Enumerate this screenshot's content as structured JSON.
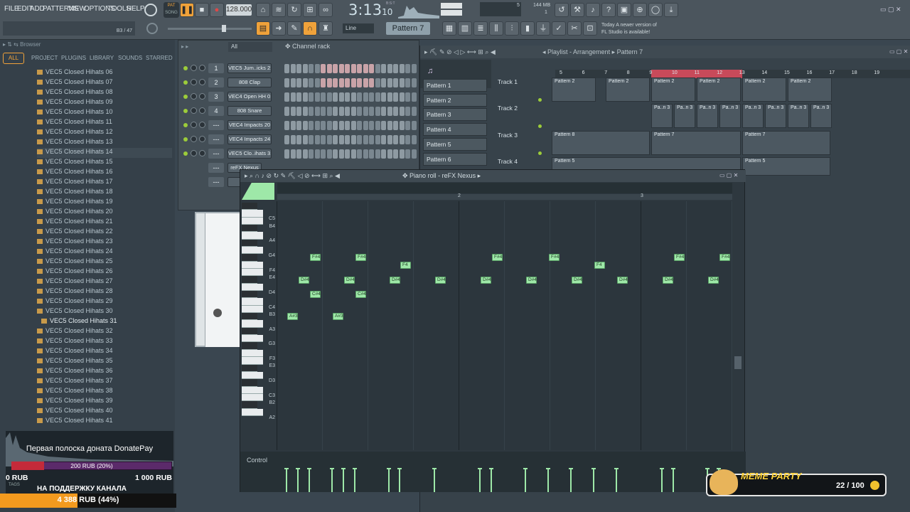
{
  "menu": [
    "FILE",
    "EDIT",
    "ADD",
    "PATTERNS",
    "VIEW",
    "OPTIONS",
    "TOOLS",
    "HELP"
  ],
  "transport": {
    "pat": "PAT",
    "song": "SONG",
    "tempo": "128.000",
    "time": "3:13",
    "time_sub": "10",
    "bst": "B:S:T",
    "cpu": "5",
    "mem": "144 MB",
    "mem2": "1",
    "hint": "B3 / 47"
  },
  "toolbar": {
    "snap": "Line",
    "pattern": "Pattern 7"
  },
  "news": {
    "line1": "Today  A newer version of",
    "line2": "FL Studio is available!"
  },
  "browser": {
    "title": "Browser",
    "tabs": [
      "ALL",
      "PROJECT",
      "PLUGINS",
      "LIBRARY",
      "SOUNDS",
      "STARRED"
    ],
    "items": [
      "VEC5 Closed Hihats 06",
      "VEC5 Closed Hihats 07",
      "VEC5 Closed Hihats 08",
      "VEC5 Closed Hihats 09",
      "VEC5 Closed Hihats 10",
      "VEC5 Closed Hihats 11",
      "VEC5 Closed Hihats 12",
      "VEC5 Closed Hihats 13",
      "VEC5 Closed Hihats 14",
      "VEC5 Closed Hihats 15",
      "VEC5 Closed Hihats 16",
      "VEC5 Closed Hihats 17",
      "VEC5 Closed Hihats 18",
      "VEC5 Closed Hihats 19",
      "VEC5 Closed Hihats 20",
      "VEC5 Closed Hihats 21",
      "VEC5 Closed Hihats 22",
      "VEC5 Closed Hihats 23",
      "VEC5 Closed Hihats 24",
      "VEC5 Closed Hihats 25",
      "VEC5 Closed Hihats 26",
      "VEC5 Closed Hihats 27",
      "VEC5 Closed Hihats 28",
      "VEC5 Closed Hihats 29",
      "VEC5 Closed Hihats 30",
      "VEC5 Closed Hihats 31",
      "VEC5 Closed Hihats 32",
      "VEC5 Closed Hihats 33",
      "VEC5 Closed Hihats 34",
      "VEC5 Closed Hihats 35",
      "VEC5 Closed Hihats 36",
      "VEC5 Closed Hihats 37",
      "VEC5 Closed Hihats 38",
      "VEC5 Closed Hihats 39",
      "VEC5 Closed Hihats 40",
      "VEC5 Closed Hihats 41"
    ]
  },
  "channel_rack": {
    "title": "Channel rack",
    "filter": "All",
    "channels": [
      {
        "num": "1",
        "name": "VEC5 Jum..icks 21"
      },
      {
        "num": "2",
        "name": "808 Clap"
      },
      {
        "num": "3",
        "name": "VEC4 Open HH 012"
      },
      {
        "num": "4",
        "name": "808 Snare"
      },
      {
        "num": "---",
        "name": "VEC4 Impacts 20"
      },
      {
        "num": "---",
        "name": "VEC4 Impacts 24"
      },
      {
        "num": "---",
        "name": "VEC5 Clo..ihats 31"
      },
      {
        "num": "---",
        "name": "reFX Nexus"
      },
      {
        "num": "---",
        "name": "re"
      }
    ]
  },
  "playlist": {
    "title": "Playlist - Arrangement",
    "crumb": "Pattern 7",
    "patterns": [
      "Pattern 1",
      "Pattern 2",
      "Pattern 3",
      "Pattern 4",
      "Pattern 5",
      "Pattern 6"
    ],
    "tracks": [
      "Track 1",
      "Track 2",
      "Track 3",
      "Track 4"
    ],
    "ruler": [
      "5",
      "6",
      "7",
      "8",
      "9",
      "10",
      "11",
      "12",
      "13",
      "14",
      "15",
      "16",
      "17",
      "18",
      "19"
    ],
    "clips": [
      {
        "label": "Pattern 2",
        "row": 0
      },
      {
        "label": "Pattern 2",
        "row": 0
      },
      {
        "label": "Pattern 2",
        "row": 0
      },
      {
        "label": "Pattern 2",
        "row": 0
      },
      {
        "label": "Pattern 2",
        "row": 0
      },
      {
        "label": "Pattern 2",
        "row": 0
      },
      {
        "label": "Pa..n 3",
        "row": 1
      },
      {
        "label": "Pattern 8",
        "row": 2
      },
      {
        "label": "Pattern 7",
        "row": 2
      },
      {
        "label": "Pattern 7",
        "row": 2
      },
      {
        "label": "Pattern 5",
        "row": 3
      },
      {
        "label": "Pattern 5",
        "row": 3
      }
    ]
  },
  "piano_roll": {
    "title": "Piano roll - reFX Nexus",
    "ruler": [
      "2",
      "3"
    ],
    "control": "Control",
    "key_labels": [
      "C5",
      "B4",
      "A4",
      "G4",
      "F4",
      "E4",
      "D4",
      "C4",
      "B3",
      "A3",
      "G3",
      "F3",
      "E3",
      "D3",
      "C3",
      "B2",
      "A2"
    ],
    "notes": [
      {
        "label": "F#4",
        "row": "F#4"
      },
      {
        "label": "F#4",
        "row": "F#4"
      },
      {
        "label": "F4",
        "row": "F4"
      },
      {
        "label": "F#4",
        "row": "F#4"
      },
      {
        "label": "F#4",
        "row": "F#4"
      },
      {
        "label": "F4",
        "row": "F4"
      },
      {
        "label": "F#4",
        "row": "F#4"
      },
      {
        "label": "F#4",
        "row": "F#4"
      },
      {
        "label": "D#4",
        "row": "D#4"
      },
      {
        "label": "D#4",
        "row": "D#4"
      },
      {
        "label": "D#4",
        "row": "D#4"
      },
      {
        "label": "D#4",
        "row": "D#4"
      },
      {
        "label": "D#4",
        "row": "D#4"
      },
      {
        "label": "D#4",
        "row": "D#4"
      },
      {
        "label": "D#4",
        "row": "D#4"
      },
      {
        "label": "D#4",
        "row": "D#4"
      },
      {
        "label": "D#4",
        "row": "D#4"
      },
      {
        "label": "D#4",
        "row": "D#4"
      },
      {
        "label": "C#4",
        "row": "C#4"
      },
      {
        "label": "C#4",
        "row": "C#4"
      },
      {
        "label": "A#3",
        "row": "A#3"
      },
      {
        "label": "A#3",
        "row": "A#3"
      }
    ]
  },
  "donate": {
    "title": "Первая полоска доната DonatePay",
    "progress": "200 RUB (20%)",
    "min": "0 RUB",
    "max": "1 000 RUB",
    "support": "НА ПОДДЕРЖКУ КАНАЛА",
    "total": "4 388 RUB (44%)",
    "tags": "TAGS"
  },
  "meme": {
    "title": "MEME PARTY",
    "count": "22 / 100"
  },
  "colors": {
    "accent": "#f0a23a",
    "note": "#9ee8a8",
    "selected_bar": "#c84a5a"
  }
}
